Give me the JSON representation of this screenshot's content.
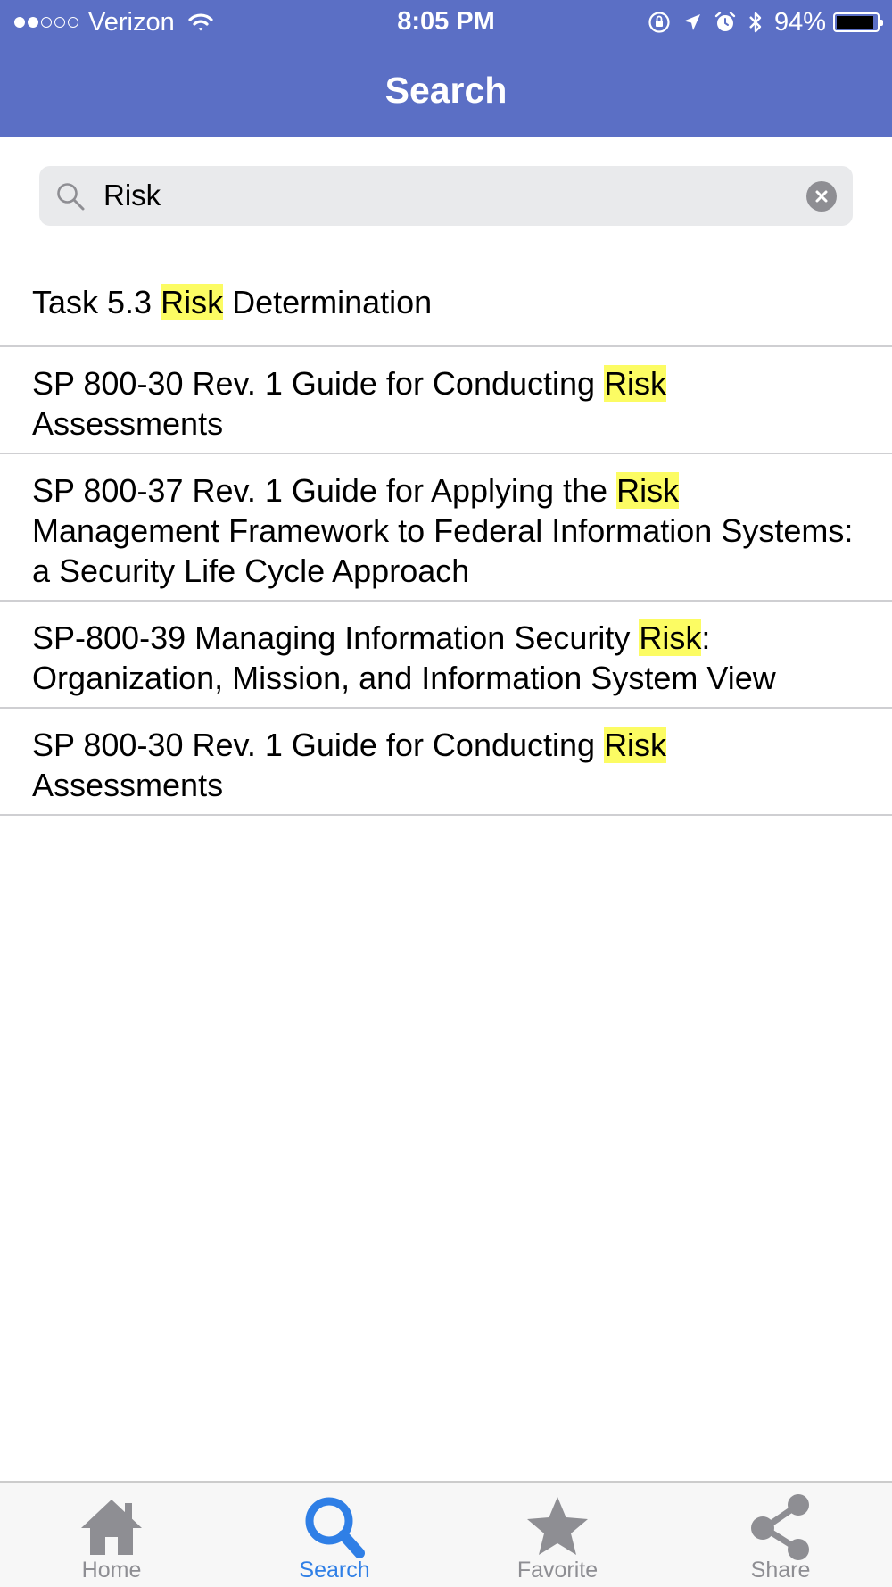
{
  "status_bar": {
    "carrier": "Verizon",
    "time": "8:05 PM",
    "battery_percent": "94%",
    "battery_level": 0.94,
    "signal_bars_filled": 2,
    "signal_bars_total": 5
  },
  "nav": {
    "title": "Search"
  },
  "search": {
    "value": "Risk"
  },
  "results": [
    {
      "before": "Task 5.3 ",
      "highlight": "Risk",
      "after": " Determination"
    },
    {
      "before": "SP 800-30 Rev. 1 Guide for Conducting ",
      "highlight": "Risk",
      "after": " Assessments"
    },
    {
      "before": "SP 800-37 Rev. 1 Guide for Applying the ",
      "highlight": "Risk",
      "after": " Management Framework to Federal Information Systems: a Security Life Cycle Approach"
    },
    {
      "before": "SP-800-39 Managing Information Security ",
      "highlight": "Risk",
      "after": ": Organization, Mission, and Information System View"
    },
    {
      "before": "SP 800-30 Rev. 1 Guide for Conducting ",
      "highlight": "Risk",
      "after": " Assessments"
    }
  ],
  "tabs": [
    {
      "label": "Home",
      "icon": "home-icon",
      "active": false
    },
    {
      "label": "Search",
      "icon": "search-icon",
      "active": true
    },
    {
      "label": "Favorite",
      "icon": "star-icon",
      "active": false
    },
    {
      "label": "Share",
      "icon": "share-icon",
      "active": false
    }
  ],
  "colors": {
    "nav_background": "#5b6fc5",
    "highlight": "#fcfc63",
    "tab_active": "#2f7fe6",
    "tab_inactive": "#8e8e93"
  }
}
